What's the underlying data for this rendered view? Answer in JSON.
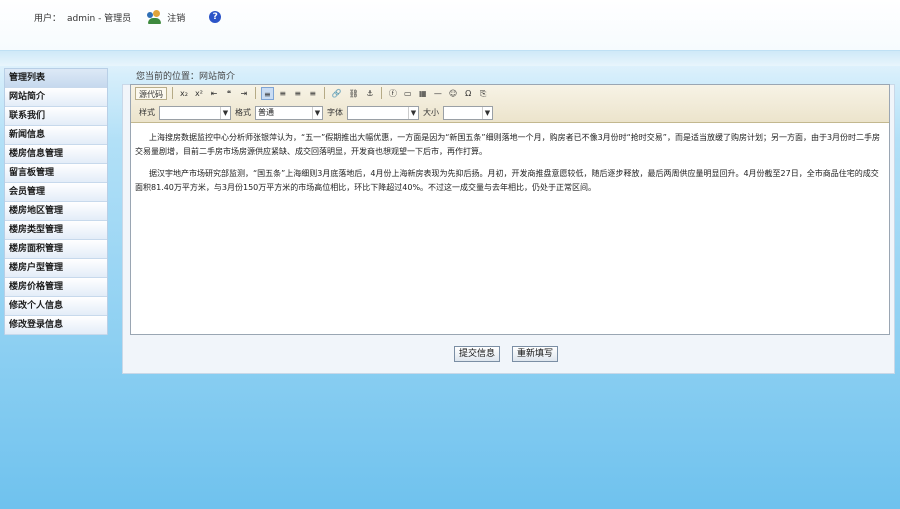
{
  "header": {
    "user_label": "用户：",
    "user_value": "admin - 管理员",
    "logout_label": "注销"
  },
  "sidebar": {
    "title": "管理列表",
    "items": [
      {
        "label": "网站简介"
      },
      {
        "label": "联系我们"
      },
      {
        "label": "新闻信息"
      },
      {
        "label": "楼房信息管理"
      },
      {
        "label": "留言板管理"
      },
      {
        "label": "会员管理"
      },
      {
        "label": "楼房地区管理"
      },
      {
        "label": "楼房类型管理"
      },
      {
        "label": "楼房面积管理"
      },
      {
        "label": "楼房户型管理"
      },
      {
        "label": "楼房价格管理"
      },
      {
        "label": "修改个人信息"
      },
      {
        "label": "修改登录信息"
      }
    ]
  },
  "breadcrumb": "您当前的位置：网站简介",
  "editor": {
    "source_label": "源代码",
    "style_label": "样式",
    "format_label": "格式",
    "format_value": "普通",
    "font_label": "字体",
    "size_label": "大小",
    "paragraphs": [
      "上海搜房数据监控中心分析师张银萍认为，“五一”假期推出大幅优惠，一方面是因为“新国五条”细则落地一个月，购房者已不像3月份时“抢时交易”，而是适当放缓了购房计划；另一方面，由于3月份时二手房交易量剧增，目前二手房市场房源供应紧缺、成交回落明显，开发商也想观望一下后市，再作打算。",
      "据汉宇地产市场研究部监测，“国五条”上海细则3月底落地后，4月份上海新房表现为先抑后扬。月初，开发商推盘意愿较低，随后逐步释放，最后两周供应量明显回升。4月份截至27日，全市商品住宅的成交面积81.40万平方米，与3月份150万平方米的市场高位相比，环比下降超过40%。不过这一成交量与去年相比，仍处于正常区间。"
    ]
  },
  "actions": {
    "submit_label": "提交信息",
    "reset_label": "重新填写"
  }
}
